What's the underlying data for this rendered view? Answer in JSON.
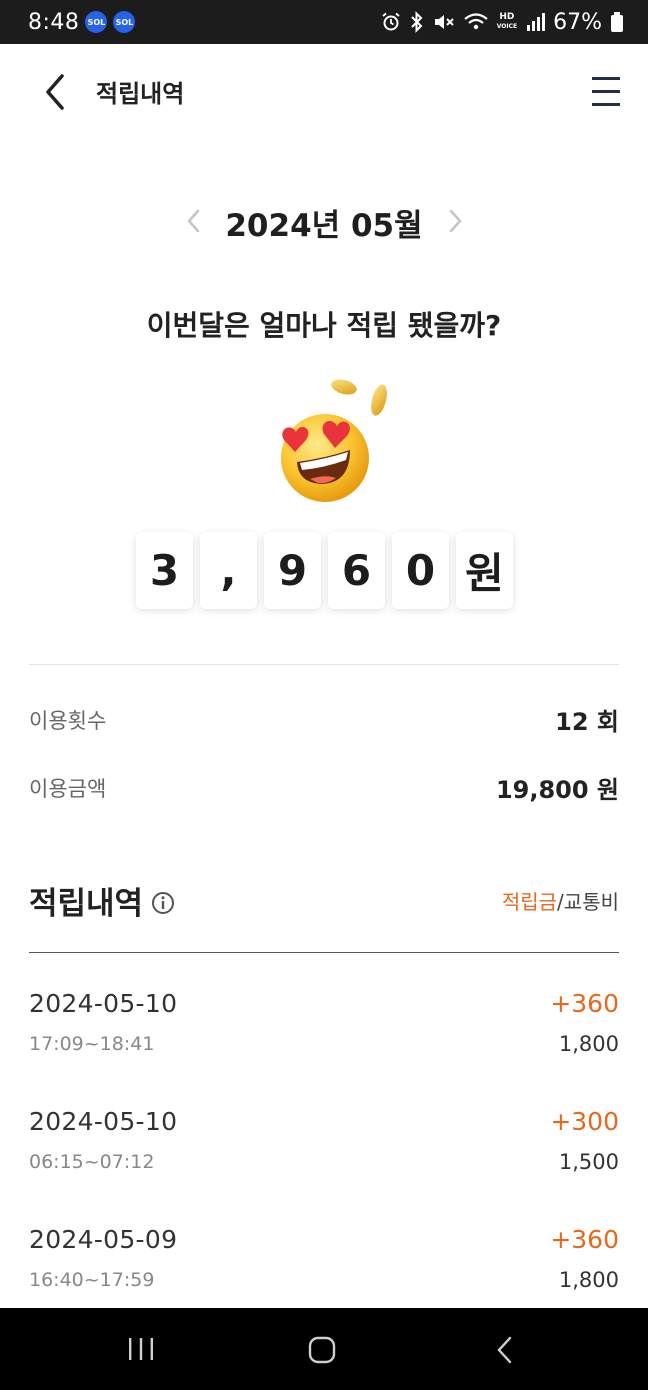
{
  "status_bar": {
    "time": "8:48",
    "apps": [
      "SOL",
      "SOL"
    ],
    "icons": [
      "alarm-icon",
      "bluetooth-icon",
      "mute-icon",
      "wifi-icon",
      "hd-voice-icon",
      "signal-icon",
      "battery-icon"
    ],
    "hd_label": "HD",
    "battery": "67%"
  },
  "header": {
    "title": "적립내역",
    "back_icon": "chevron-left-icon",
    "menu_icon": "hamburger-menu-icon"
  },
  "month_nav": {
    "label": "2024년 05월",
    "prev_icon": "chevron-left-icon",
    "next_icon": "chevron-right-icon"
  },
  "summary": {
    "question": "이번달은 얼마나 적립 됐을까?",
    "emoji_icon": "heart-eyes-emoji-with-coins",
    "amount_chars": [
      "3",
      ",",
      "9",
      "6",
      "0",
      "원"
    ]
  },
  "stats": {
    "usage_count_label": "이용횟수",
    "usage_count_value": "12 회",
    "usage_amount_label": "이용금액",
    "usage_amount_value": "19,800 원"
  },
  "history": {
    "title": "적립내역",
    "info_icon": "info-icon",
    "toggle_active": "적립금",
    "toggle_separator": "/",
    "toggle_inactive": "교통비",
    "entries": [
      {
        "date": "2024-05-10",
        "points": "+360",
        "time": "17:09~18:41",
        "fare": "1,800"
      },
      {
        "date": "2024-05-10",
        "points": "+300",
        "time": "06:15~07:12",
        "fare": "1,500"
      },
      {
        "date": "2024-05-09",
        "points": "+360",
        "time": "16:40~17:59",
        "fare": "1,800"
      }
    ]
  },
  "nav_bar": {
    "icons": [
      "recent-apps-icon",
      "home-icon",
      "back-icon"
    ]
  },
  "colors": {
    "accent": "#e8671c",
    "status_bar_bg": "#1c1c1c",
    "nav_bar_bg": "#000000"
  }
}
